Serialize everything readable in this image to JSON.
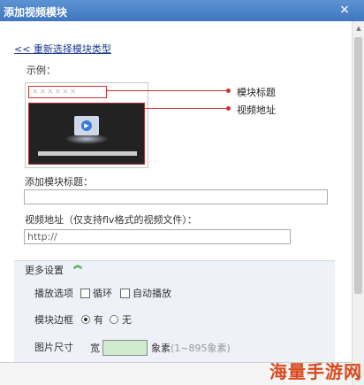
{
  "dialog": {
    "title": "添加视频模块",
    "close_glyph": "×"
  },
  "back_link": "<< 重新选择模块类型",
  "example_label": "示例：",
  "preview": {
    "placeholder_title": "××××××",
    "callouts": [
      "模块标题",
      "视频地址"
    ]
  },
  "module_title": {
    "label": "添加模块标题：",
    "value": ""
  },
  "video_url": {
    "label": "视频地址（仅支持flv格式的视频文件）：",
    "value": "http://"
  },
  "more_settings": {
    "title": "更多设置",
    "playback": {
      "label": "播放选项",
      "options": [
        "循环",
        "自动播放"
      ]
    },
    "border": {
      "label": "模块边框",
      "options": [
        "有",
        "无"
      ],
      "selected": "有"
    },
    "image_size": {
      "label": "图片尺寸",
      "width_label": "宽",
      "unit": "象素",
      "hint": "(1~895象素)"
    }
  },
  "watermark": "海量手游网",
  "icons": {
    "close": "close-icon",
    "collapse": "chevron-up-icon",
    "play": "play-icon"
  },
  "colors": {
    "titlebar": "#4a82c8",
    "callout": "#cc3333",
    "panel": "#eef2f8",
    "size_field": "#cfeccf",
    "watermark": "#d94a1e"
  }
}
